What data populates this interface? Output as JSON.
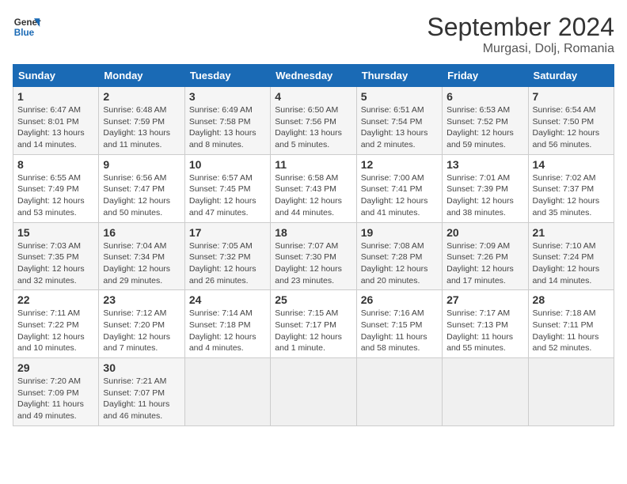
{
  "header": {
    "logo": {
      "line1": "General",
      "line2": "Blue"
    },
    "title": "September 2024",
    "subtitle": "Murgasi, Dolj, Romania"
  },
  "days_of_week": [
    "Sunday",
    "Monday",
    "Tuesday",
    "Wednesday",
    "Thursday",
    "Friday",
    "Saturday"
  ],
  "weeks": [
    [
      {
        "day": "1",
        "info": "Sunrise: 6:47 AM\nSunset: 8:01 PM\nDaylight: 13 hours and 14 minutes."
      },
      {
        "day": "2",
        "info": "Sunrise: 6:48 AM\nSunset: 7:59 PM\nDaylight: 13 hours and 11 minutes."
      },
      {
        "day": "3",
        "info": "Sunrise: 6:49 AM\nSunset: 7:58 PM\nDaylight: 13 hours and 8 minutes."
      },
      {
        "day": "4",
        "info": "Sunrise: 6:50 AM\nSunset: 7:56 PM\nDaylight: 13 hours and 5 minutes."
      },
      {
        "day": "5",
        "info": "Sunrise: 6:51 AM\nSunset: 7:54 PM\nDaylight: 13 hours and 2 minutes."
      },
      {
        "day": "6",
        "info": "Sunrise: 6:53 AM\nSunset: 7:52 PM\nDaylight: 12 hours and 59 minutes."
      },
      {
        "day": "7",
        "info": "Sunrise: 6:54 AM\nSunset: 7:50 PM\nDaylight: 12 hours and 56 minutes."
      }
    ],
    [
      {
        "day": "8",
        "info": "Sunrise: 6:55 AM\nSunset: 7:49 PM\nDaylight: 12 hours and 53 minutes."
      },
      {
        "day": "9",
        "info": "Sunrise: 6:56 AM\nSunset: 7:47 PM\nDaylight: 12 hours and 50 minutes."
      },
      {
        "day": "10",
        "info": "Sunrise: 6:57 AM\nSunset: 7:45 PM\nDaylight: 12 hours and 47 minutes."
      },
      {
        "day": "11",
        "info": "Sunrise: 6:58 AM\nSunset: 7:43 PM\nDaylight: 12 hours and 44 minutes."
      },
      {
        "day": "12",
        "info": "Sunrise: 7:00 AM\nSunset: 7:41 PM\nDaylight: 12 hours and 41 minutes."
      },
      {
        "day": "13",
        "info": "Sunrise: 7:01 AM\nSunset: 7:39 PM\nDaylight: 12 hours and 38 minutes."
      },
      {
        "day": "14",
        "info": "Sunrise: 7:02 AM\nSunset: 7:37 PM\nDaylight: 12 hours and 35 minutes."
      }
    ],
    [
      {
        "day": "15",
        "info": "Sunrise: 7:03 AM\nSunset: 7:35 PM\nDaylight: 12 hours and 32 minutes."
      },
      {
        "day": "16",
        "info": "Sunrise: 7:04 AM\nSunset: 7:34 PM\nDaylight: 12 hours and 29 minutes."
      },
      {
        "day": "17",
        "info": "Sunrise: 7:05 AM\nSunset: 7:32 PM\nDaylight: 12 hours and 26 minutes."
      },
      {
        "day": "18",
        "info": "Sunrise: 7:07 AM\nSunset: 7:30 PM\nDaylight: 12 hours and 23 minutes."
      },
      {
        "day": "19",
        "info": "Sunrise: 7:08 AM\nSunset: 7:28 PM\nDaylight: 12 hours and 20 minutes."
      },
      {
        "day": "20",
        "info": "Sunrise: 7:09 AM\nSunset: 7:26 PM\nDaylight: 12 hours and 17 minutes."
      },
      {
        "day": "21",
        "info": "Sunrise: 7:10 AM\nSunset: 7:24 PM\nDaylight: 12 hours and 14 minutes."
      }
    ],
    [
      {
        "day": "22",
        "info": "Sunrise: 7:11 AM\nSunset: 7:22 PM\nDaylight: 12 hours and 10 minutes."
      },
      {
        "day": "23",
        "info": "Sunrise: 7:12 AM\nSunset: 7:20 PM\nDaylight: 12 hours and 7 minutes."
      },
      {
        "day": "24",
        "info": "Sunrise: 7:14 AM\nSunset: 7:18 PM\nDaylight: 12 hours and 4 minutes."
      },
      {
        "day": "25",
        "info": "Sunrise: 7:15 AM\nSunset: 7:17 PM\nDaylight: 12 hours and 1 minute."
      },
      {
        "day": "26",
        "info": "Sunrise: 7:16 AM\nSunset: 7:15 PM\nDaylight: 11 hours and 58 minutes."
      },
      {
        "day": "27",
        "info": "Sunrise: 7:17 AM\nSunset: 7:13 PM\nDaylight: 11 hours and 55 minutes."
      },
      {
        "day": "28",
        "info": "Sunrise: 7:18 AM\nSunset: 7:11 PM\nDaylight: 11 hours and 52 minutes."
      }
    ],
    [
      {
        "day": "29",
        "info": "Sunrise: 7:20 AM\nSunset: 7:09 PM\nDaylight: 11 hours and 49 minutes."
      },
      {
        "day": "30",
        "info": "Sunrise: 7:21 AM\nSunset: 7:07 PM\nDaylight: 11 hours and 46 minutes."
      },
      {
        "day": "",
        "info": ""
      },
      {
        "day": "",
        "info": ""
      },
      {
        "day": "",
        "info": ""
      },
      {
        "day": "",
        "info": ""
      },
      {
        "day": "",
        "info": ""
      }
    ]
  ]
}
